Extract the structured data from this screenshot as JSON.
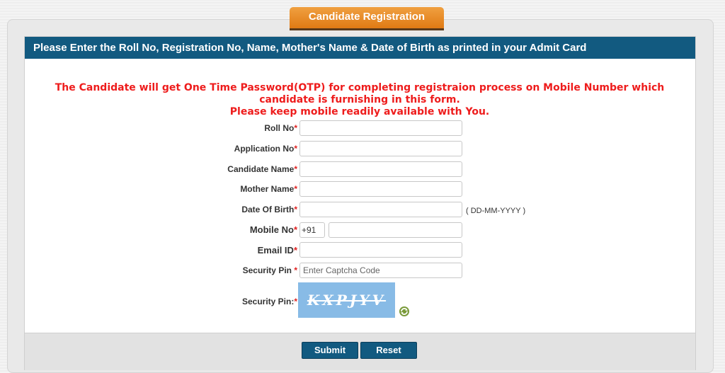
{
  "tab_title": "Candidate Registration",
  "panel_header": "Please Enter the Roll No, Registration  No, Name, Mother's Name & Date of Birth as printed in your Admit Card",
  "notice": {
    "line1": "The Candidate will get One Time Password(OTP) for completing registraion process on Mobile Number which",
    "line2": "candidate is furnishing in this form.",
    "line3": "Please keep mobile readily available with You."
  },
  "fields": {
    "roll_no": {
      "label": "Roll No",
      "value": ""
    },
    "application_no": {
      "label": "Application No",
      "value": ""
    },
    "candidate_name": {
      "label": "Candidate Name",
      "value": ""
    },
    "mother_name": {
      "label": "Mother Name",
      "value": ""
    },
    "dob": {
      "label": "Date Of Birth",
      "value": "",
      "hint": "( DD-MM-YYYY )"
    },
    "mobile": {
      "label": "Mobile No",
      "country_code": "+91",
      "value": ""
    },
    "email": {
      "label": "Email ID",
      "value": ""
    },
    "security_pin": {
      "label": "Security Pin",
      "placeholder": "Enter Captcha Code",
      "value": ""
    },
    "captcha": {
      "label": "Security Pin:",
      "text": "KXPJYV"
    }
  },
  "required_marker": "*",
  "buttons": {
    "submit": "Submit",
    "reset": "Reset"
  },
  "colors": {
    "header_blue": "#125a80",
    "tab_orange": "#e07a14",
    "notice_red": "#ee1c1c",
    "captcha_bg": "#88bbe6"
  },
  "icons": {
    "refresh": "refresh-captcha-icon"
  }
}
